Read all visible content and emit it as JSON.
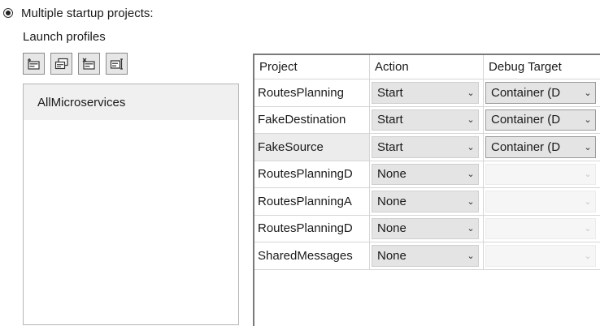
{
  "startup": {
    "option_label": "Multiple startup projects:",
    "selected": true
  },
  "launch_profiles": {
    "label": "Launch profiles",
    "toolbar_icons": [
      "new-profile-icon",
      "duplicate-profile-icon",
      "delete-profile-icon",
      "rename-profile-icon"
    ],
    "items": [
      {
        "label": "AllMicroservices",
        "selected": true
      }
    ]
  },
  "grid": {
    "columns": [
      "Project",
      "Action",
      "Debug Target"
    ],
    "rows": [
      {
        "project": "RoutesPlanning",
        "action": "Start",
        "target": "Container (D"
      },
      {
        "project": "FakeDestination",
        "action": "Start",
        "target": "Container (D"
      },
      {
        "project": "FakeSource",
        "action": "Start",
        "target": "Container (D",
        "selected": true
      },
      {
        "project": "RoutesPlanningD",
        "action": "None",
        "target": ""
      },
      {
        "project": "RoutesPlanningA",
        "action": "None",
        "target": ""
      },
      {
        "project": "RoutesPlanningD",
        "action": "None",
        "target": ""
      },
      {
        "project": "SharedMessages",
        "action": "None",
        "target": ""
      }
    ]
  },
  "icons": {
    "dropdown": "chevron-down-icon",
    "radio": "radio-selected-icon"
  },
  "colors": {
    "combo_background": "#e4e4e4",
    "selected_row": "#ececec",
    "grid_lines": "#d6d6d6"
  }
}
